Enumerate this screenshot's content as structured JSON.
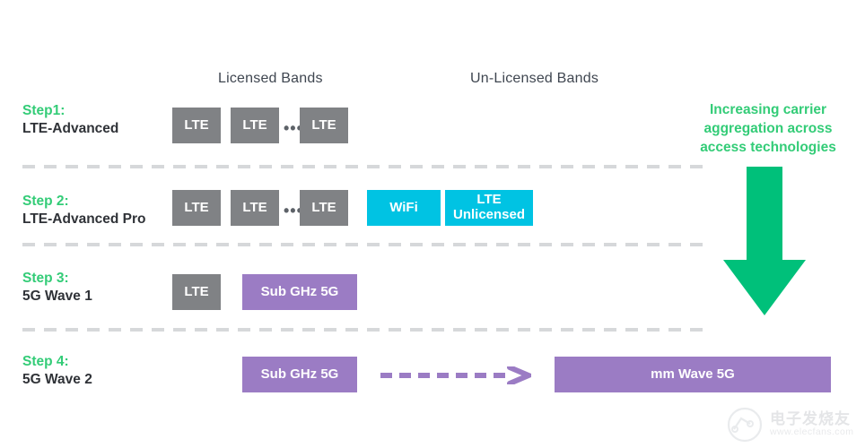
{
  "headers": {
    "licensed": "Licensed Bands",
    "unlicensed": "Un-Licensed Bands"
  },
  "rows": [
    {
      "step": "Step1:",
      "name": "LTE-Advanced",
      "boxes": [
        {
          "label": "LTE",
          "color": "#808285"
        },
        {
          "label": "LTE",
          "color": "#808285"
        },
        {
          "label": "LTE",
          "color": "#808285"
        }
      ],
      "ellipsis": "•••"
    },
    {
      "step": "Step 2:",
      "name": "LTE-Advanced Pro",
      "boxes": [
        {
          "label": "LTE",
          "color": "#808285"
        },
        {
          "label": "LTE",
          "color": "#808285"
        },
        {
          "label": "LTE",
          "color": "#808285"
        },
        {
          "label": "WiFi",
          "color": "#00c3e3"
        },
        {
          "label": "LTE\nUnlicensed",
          "color": "#00c3e3"
        }
      ],
      "ellipsis": "•••"
    },
    {
      "step": "Step 3:",
      "name": "5G Wave  1",
      "boxes": [
        {
          "label": "LTE",
          "color": "#808285"
        },
        {
          "label": "Sub GHz 5G",
          "color": "#9b7cc4"
        }
      ]
    },
    {
      "step": "Step 4:",
      "name": "5G Wave 2",
      "boxes": [
        {
          "label": "Sub GHz 5G",
          "color": "#9b7cc4"
        },
        {
          "label": "mm Wave 5G",
          "color": "#9b7cc4"
        }
      ],
      "connector": "dashed-arrow-right"
    }
  ],
  "boxes": {
    "r1_lte_1": "LTE",
    "r1_lte_2": "LTE",
    "r1_lte_3": "LTE",
    "r2_lte_1": "LTE",
    "r2_lte_2": "LTE",
    "r2_lte_3": "LTE",
    "r2_wifi": "WiFi",
    "r2_lte_unlicensed_line1": "LTE",
    "r2_lte_unlicensed_line2": "Unlicensed",
    "r3_lte": "LTE",
    "r3_sub_ghz": "Sub GHz 5G",
    "r4_sub_ghz": "Sub GHz 5G",
    "r4_mm_wave": "mm Wave 5G"
  },
  "ellipsis": "•••",
  "callout": {
    "line1": "Increasing carrier",
    "line2": "aggregation across",
    "line3": "access technologies",
    "arrow_icon": "down-arrow-icon"
  },
  "watermark": {
    "text": "电子发烧友",
    "url": "www.elecfans.com",
    "logo_icon": "circuit-circle-logo-icon"
  },
  "colors": {
    "green": "#33cc77",
    "gray": "#808285",
    "cyan": "#00c3e3",
    "purple": "#9b7cc4",
    "separator": "#d6d8da",
    "text_dark": "#2f3237",
    "header_text": "#3f4650"
  }
}
